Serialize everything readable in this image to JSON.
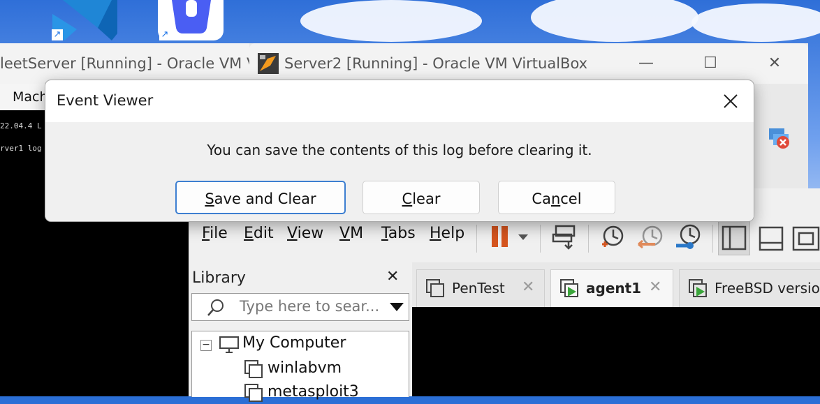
{
  "desktop": {
    "icons": [
      {
        "name": "vscode-shortcut",
        "color": "#1f86d6"
      },
      {
        "name": "trash-app-shortcut",
        "color": "#4a5ef3"
      }
    ],
    "shortcut_glyph": "↗"
  },
  "window_back": {
    "title": "leetServer [Running] - Oracle VM V",
    "menu_first": "Mach",
    "terminal_lines": [
      "22.04.4 L",
      "rver1 log"
    ]
  },
  "window_server2": {
    "title": "Server2 [Running] - Oracle VM VirtualBox",
    "controls": {
      "minimize": "—",
      "maximize": "☐",
      "close": "✕"
    }
  },
  "vmware": {
    "menu": [
      {
        "label": "File",
        "accel": "F",
        "rest": "ile"
      },
      {
        "label": "Edit",
        "accel": "E",
        "rest": "dit"
      },
      {
        "label": "View",
        "accel": "V",
        "rest": "iew"
      },
      {
        "label": "VM",
        "accel": "V",
        "rest": "M"
      },
      {
        "label": "Tabs",
        "accel": "T",
        "rest": "abs"
      },
      {
        "label": "Help",
        "accel": "H",
        "rest": "elp"
      }
    ],
    "library": {
      "title": "Library",
      "close": "✕",
      "search_placeholder": "Type here to sear...",
      "tree": [
        {
          "label": "My Computer",
          "expander": "−"
        },
        {
          "label": "winlabvm"
        },
        {
          "label": "metasploit3"
        }
      ]
    },
    "tabs": [
      {
        "label": "PenTest",
        "close": "✕",
        "active": false
      },
      {
        "label": "agent1",
        "close": "✕",
        "active": true
      },
      {
        "label": "FreeBSD version",
        "active": false
      }
    ]
  },
  "dialog": {
    "title": "Event Viewer",
    "close": "✕",
    "message": "You can save the contents of this log before clearing it.",
    "buttons": [
      {
        "label": "Save and Clear",
        "accel": "S",
        "rest": "ave and Clear",
        "default": true
      },
      {
        "label": "Clear",
        "accel": "C",
        "rest": "lear",
        "default": false
      },
      {
        "label": "Cancel",
        "pre": "Ca",
        "accel": "n",
        "rest": "cel",
        "default": false
      }
    ]
  }
}
